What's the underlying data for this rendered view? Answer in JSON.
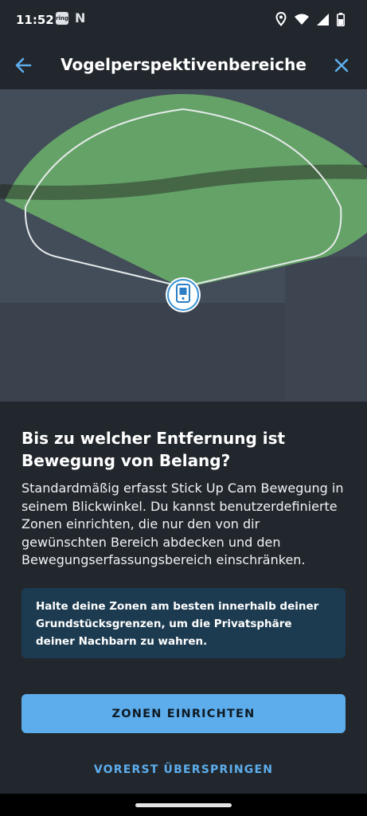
{
  "status_bar": {
    "time": "11:52",
    "app_icon_label": "ring",
    "n_icon_label": "N",
    "icons": [
      "location-icon",
      "wifi-icon",
      "cell-signal-icon",
      "battery-icon"
    ]
  },
  "header": {
    "title": "Vogelperspektivenbereiche",
    "back_icon": "arrow-left-icon",
    "close_icon": "close-icon",
    "accent_color": "#5dadec"
  },
  "map": {
    "device_icon": "camera-device-icon",
    "zone_color": "#6db66b"
  },
  "content": {
    "headline": "Bis zu welcher Entfernung ist Bewegung von Belang?",
    "body": "Standardmäßig erfasst Stick Up Cam Bewegung in seinem Blickwinkel. Du kannst benutzerdefinierte Zonen einrichten, die nur den von dir gewünschten Bereich abdecken und den Bewegungserfassungsbereich einschränken."
  },
  "info_box": {
    "text": "Halte deine Zonen am besten innerhalb deiner Grundstücksgrenzen, um die Privatsphäre deiner Nachbarn zu wahren."
  },
  "actions": {
    "primary_label": "ZONEN EINRICHTEN",
    "secondary_label": "VORERST ÜBERSPRINGEN"
  }
}
